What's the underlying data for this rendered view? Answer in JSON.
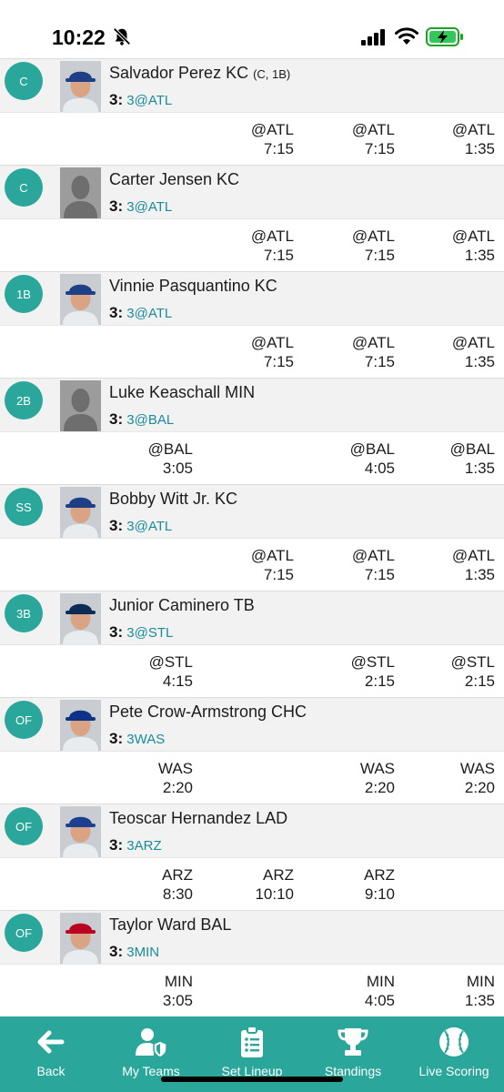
{
  "status_bar": {
    "time": "10:22"
  },
  "players": [
    {
      "pos": "C",
      "name": "Salvador Perez KC",
      "elig": "(C, 1B)",
      "games_count": "3:",
      "games_opp": "3@ATL",
      "photo": "kc",
      "slots": [
        null,
        {
          "opp": "@ATL",
          "time": "7:15"
        },
        {
          "opp": "@ATL",
          "time": "7:15"
        },
        {
          "opp": "@ATL",
          "time": "1:35"
        }
      ]
    },
    {
      "pos": "C",
      "name": "Carter Jensen KC",
      "elig": "",
      "games_count": "3:",
      "games_opp": "3@ATL",
      "photo": "none",
      "slots": [
        null,
        {
          "opp": "@ATL",
          "time": "7:15"
        },
        {
          "opp": "@ATL",
          "time": "7:15"
        },
        {
          "opp": "@ATL",
          "time": "1:35"
        }
      ]
    },
    {
      "pos": "1B",
      "name": "Vinnie Pasquantino KC",
      "elig": "",
      "games_count": "3:",
      "games_opp": "3@ATL",
      "photo": "kc",
      "slots": [
        null,
        {
          "opp": "@ATL",
          "time": "7:15"
        },
        {
          "opp": "@ATL",
          "time": "7:15"
        },
        {
          "opp": "@ATL",
          "time": "1:35"
        }
      ]
    },
    {
      "pos": "2B",
      "name": "Luke Keaschall MIN",
      "elig": "",
      "games_count": "3:",
      "games_opp": "3@BAL",
      "photo": "none",
      "slots": [
        {
          "opp": "@BAL",
          "time": "3:05"
        },
        null,
        {
          "opp": "@BAL",
          "time": "4:05"
        },
        {
          "opp": "@BAL",
          "time": "1:35"
        }
      ]
    },
    {
      "pos": "SS",
      "name": "Bobby Witt Jr. KC",
      "elig": "",
      "games_count": "3:",
      "games_opp": "3@ATL",
      "photo": "kc",
      "slots": [
        null,
        {
          "opp": "@ATL",
          "time": "7:15"
        },
        {
          "opp": "@ATL",
          "time": "7:15"
        },
        {
          "opp": "@ATL",
          "time": "1:35"
        }
      ]
    },
    {
      "pos": "3B",
      "name": "Junior Caminero TB",
      "elig": "",
      "games_count": "3:",
      "games_opp": "3@STL",
      "photo": "tb",
      "slots": [
        {
          "opp": "@STL",
          "time": "4:15"
        },
        null,
        {
          "opp": "@STL",
          "time": "2:15"
        },
        {
          "opp": "@STL",
          "time": "2:15"
        }
      ]
    },
    {
      "pos": "OF",
      "name": "Pete Crow-Armstrong CHC",
      "elig": "",
      "games_count": "3:",
      "games_opp": "3WAS",
      "photo": "chc",
      "slots": [
        {
          "opp": "WAS",
          "time": "2:20"
        },
        null,
        {
          "opp": "WAS",
          "time": "2:20"
        },
        {
          "opp": "WAS",
          "time": "2:20"
        }
      ]
    },
    {
      "pos": "OF",
      "name": "Teoscar Hernandez LAD",
      "elig": "",
      "games_count": "3:",
      "games_opp": "3ARZ",
      "photo": "lad",
      "slots": [
        {
          "opp": "ARZ",
          "time": "8:30"
        },
        {
          "opp": "ARZ",
          "time": "10:10"
        },
        {
          "opp": "ARZ",
          "time": "9:10"
        },
        null
      ]
    },
    {
      "pos": "OF",
      "name": "Taylor Ward BAL",
      "elig": "",
      "games_count": "3:",
      "games_opp": "3MIN",
      "photo": "laa",
      "slots": [
        {
          "opp": "MIN",
          "time": "3:05"
        },
        null,
        {
          "opp": "MIN",
          "time": "4:05"
        },
        {
          "opp": "MIN",
          "time": "1:35"
        }
      ]
    }
  ],
  "tabbar": {
    "tabs": [
      {
        "label": "Back",
        "icon": "back-arrow-icon"
      },
      {
        "label": "My Teams",
        "icon": "user-shield-icon"
      },
      {
        "label": "Set Lineup",
        "icon": "clipboard-list-icon"
      },
      {
        "label": "Standings",
        "icon": "trophy-icon"
      },
      {
        "label": "Live Scoring",
        "icon": "baseball-icon"
      }
    ]
  },
  "colors": {
    "accent": "#2aa69b",
    "link": "#1a8b9a",
    "row_bg": "#f2f2f2"
  }
}
